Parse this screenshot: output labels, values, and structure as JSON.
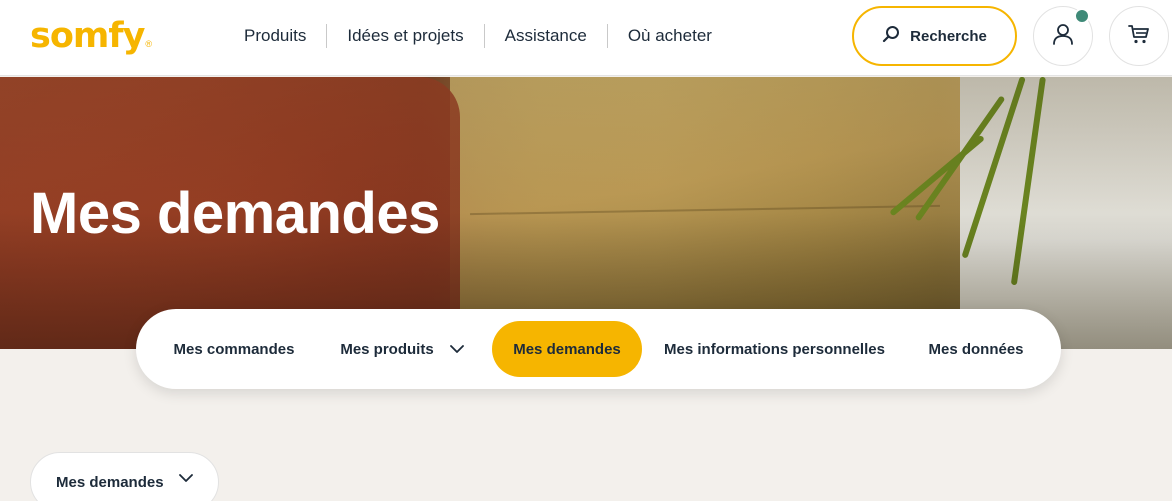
{
  "header": {
    "logo_text": "somfy",
    "logo_reg": "®",
    "nav": [
      {
        "label": "Produits"
      },
      {
        "label": "Idées et projets"
      },
      {
        "label": "Assistance"
      },
      {
        "label": "Où acheter"
      }
    ],
    "search_label": "Recherche",
    "icons": {
      "search": "search-icon",
      "user": "user-icon",
      "cart": "cart-icon"
    },
    "status_dot_color": "#3f8a78"
  },
  "hero": {
    "title": "Mes demandes"
  },
  "tabs": [
    {
      "label": "Mes commandes",
      "active": false
    },
    {
      "label": "Mes produits",
      "active": false,
      "has_dropdown": true
    },
    {
      "label": "Mes demandes",
      "active": true
    },
    {
      "label": "Mes informations personnelles",
      "active": false
    },
    {
      "label": "Mes données",
      "active": false
    }
  ],
  "filter_dropdown": {
    "label": "Mes demandes"
  },
  "colors": {
    "brand_yellow": "#f6b500",
    "text_dark": "#1d2b3a",
    "page_bg": "#f3f0ec"
  }
}
